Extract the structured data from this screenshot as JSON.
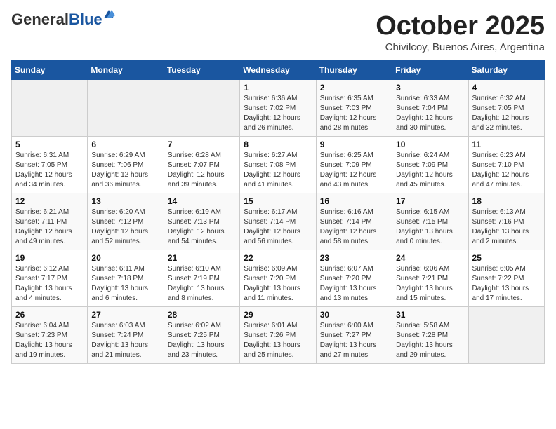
{
  "logo": {
    "general": "General",
    "blue": "Blue"
  },
  "title": {
    "month": "October 2025",
    "location": "Chivilcoy, Buenos Aires, Argentina"
  },
  "headers": [
    "Sunday",
    "Monday",
    "Tuesday",
    "Wednesday",
    "Thursday",
    "Friday",
    "Saturday"
  ],
  "weeks": [
    [
      {
        "day": "",
        "info": ""
      },
      {
        "day": "",
        "info": ""
      },
      {
        "day": "",
        "info": ""
      },
      {
        "day": "1",
        "info": "Sunrise: 6:36 AM\nSunset: 7:02 PM\nDaylight: 12 hours\nand 26 minutes."
      },
      {
        "day": "2",
        "info": "Sunrise: 6:35 AM\nSunset: 7:03 PM\nDaylight: 12 hours\nand 28 minutes."
      },
      {
        "day": "3",
        "info": "Sunrise: 6:33 AM\nSunset: 7:04 PM\nDaylight: 12 hours\nand 30 minutes."
      },
      {
        "day": "4",
        "info": "Sunrise: 6:32 AM\nSunset: 7:05 PM\nDaylight: 12 hours\nand 32 minutes."
      }
    ],
    [
      {
        "day": "5",
        "info": "Sunrise: 6:31 AM\nSunset: 7:05 PM\nDaylight: 12 hours\nand 34 minutes."
      },
      {
        "day": "6",
        "info": "Sunrise: 6:29 AM\nSunset: 7:06 PM\nDaylight: 12 hours\nand 36 minutes."
      },
      {
        "day": "7",
        "info": "Sunrise: 6:28 AM\nSunset: 7:07 PM\nDaylight: 12 hours\nand 39 minutes."
      },
      {
        "day": "8",
        "info": "Sunrise: 6:27 AM\nSunset: 7:08 PM\nDaylight: 12 hours\nand 41 minutes."
      },
      {
        "day": "9",
        "info": "Sunrise: 6:25 AM\nSunset: 7:09 PM\nDaylight: 12 hours\nand 43 minutes."
      },
      {
        "day": "10",
        "info": "Sunrise: 6:24 AM\nSunset: 7:09 PM\nDaylight: 12 hours\nand 45 minutes."
      },
      {
        "day": "11",
        "info": "Sunrise: 6:23 AM\nSunset: 7:10 PM\nDaylight: 12 hours\nand 47 minutes."
      }
    ],
    [
      {
        "day": "12",
        "info": "Sunrise: 6:21 AM\nSunset: 7:11 PM\nDaylight: 12 hours\nand 49 minutes."
      },
      {
        "day": "13",
        "info": "Sunrise: 6:20 AM\nSunset: 7:12 PM\nDaylight: 12 hours\nand 52 minutes."
      },
      {
        "day": "14",
        "info": "Sunrise: 6:19 AM\nSunset: 7:13 PM\nDaylight: 12 hours\nand 54 minutes."
      },
      {
        "day": "15",
        "info": "Sunrise: 6:17 AM\nSunset: 7:14 PM\nDaylight: 12 hours\nand 56 minutes."
      },
      {
        "day": "16",
        "info": "Sunrise: 6:16 AM\nSunset: 7:14 PM\nDaylight: 12 hours\nand 58 minutes."
      },
      {
        "day": "17",
        "info": "Sunrise: 6:15 AM\nSunset: 7:15 PM\nDaylight: 13 hours\nand 0 minutes."
      },
      {
        "day": "18",
        "info": "Sunrise: 6:13 AM\nSunset: 7:16 PM\nDaylight: 13 hours\nand 2 minutes."
      }
    ],
    [
      {
        "day": "19",
        "info": "Sunrise: 6:12 AM\nSunset: 7:17 PM\nDaylight: 13 hours\nand 4 minutes."
      },
      {
        "day": "20",
        "info": "Sunrise: 6:11 AM\nSunset: 7:18 PM\nDaylight: 13 hours\nand 6 minutes."
      },
      {
        "day": "21",
        "info": "Sunrise: 6:10 AM\nSunset: 7:19 PM\nDaylight: 13 hours\nand 8 minutes."
      },
      {
        "day": "22",
        "info": "Sunrise: 6:09 AM\nSunset: 7:20 PM\nDaylight: 13 hours\nand 11 minutes."
      },
      {
        "day": "23",
        "info": "Sunrise: 6:07 AM\nSunset: 7:20 PM\nDaylight: 13 hours\nand 13 minutes."
      },
      {
        "day": "24",
        "info": "Sunrise: 6:06 AM\nSunset: 7:21 PM\nDaylight: 13 hours\nand 15 minutes."
      },
      {
        "day": "25",
        "info": "Sunrise: 6:05 AM\nSunset: 7:22 PM\nDaylight: 13 hours\nand 17 minutes."
      }
    ],
    [
      {
        "day": "26",
        "info": "Sunrise: 6:04 AM\nSunset: 7:23 PM\nDaylight: 13 hours\nand 19 minutes."
      },
      {
        "day": "27",
        "info": "Sunrise: 6:03 AM\nSunset: 7:24 PM\nDaylight: 13 hours\nand 21 minutes."
      },
      {
        "day": "28",
        "info": "Sunrise: 6:02 AM\nSunset: 7:25 PM\nDaylight: 13 hours\nand 23 minutes."
      },
      {
        "day": "29",
        "info": "Sunrise: 6:01 AM\nSunset: 7:26 PM\nDaylight: 13 hours\nand 25 minutes."
      },
      {
        "day": "30",
        "info": "Sunrise: 6:00 AM\nSunset: 7:27 PM\nDaylight: 13 hours\nand 27 minutes."
      },
      {
        "day": "31",
        "info": "Sunrise: 5:58 AM\nSunset: 7:28 PM\nDaylight: 13 hours\nand 29 minutes."
      },
      {
        "day": "",
        "info": ""
      }
    ]
  ]
}
